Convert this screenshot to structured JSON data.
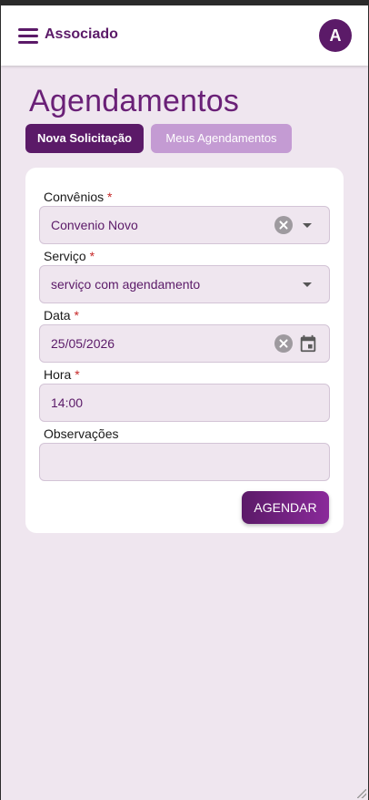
{
  "appbar": {
    "title": "Associado",
    "avatar_letter": "A"
  },
  "page": {
    "title": "Agendamentos"
  },
  "tabs": [
    {
      "label": "Nova Solicitação",
      "active": true
    },
    {
      "label": "Meus Agendamentos",
      "active": false
    }
  ],
  "form": {
    "convenios": {
      "label": "Convênios",
      "required_mark": "*",
      "value": "Convenio Novo"
    },
    "servico": {
      "label": "Serviço",
      "required_mark": "*",
      "value": "serviço com agendamento"
    },
    "data": {
      "label": "Data",
      "required_mark": "*",
      "value": "25/05/2026"
    },
    "hora": {
      "label": "Hora",
      "required_mark": "*",
      "value": "14:00"
    },
    "observacoes": {
      "label": "Observações",
      "value": ""
    },
    "submit_label": "AGENDAR"
  },
  "colors": {
    "brand": "#5b1a68",
    "brand_light": "#c49bd3",
    "background": "#efe6ef",
    "required": "#c62828"
  },
  "icons": {
    "menu": "hamburger-menu-icon",
    "clear": "clear-circle-icon",
    "dropdown": "chevron-down-icon",
    "calendar": "calendar-icon"
  }
}
